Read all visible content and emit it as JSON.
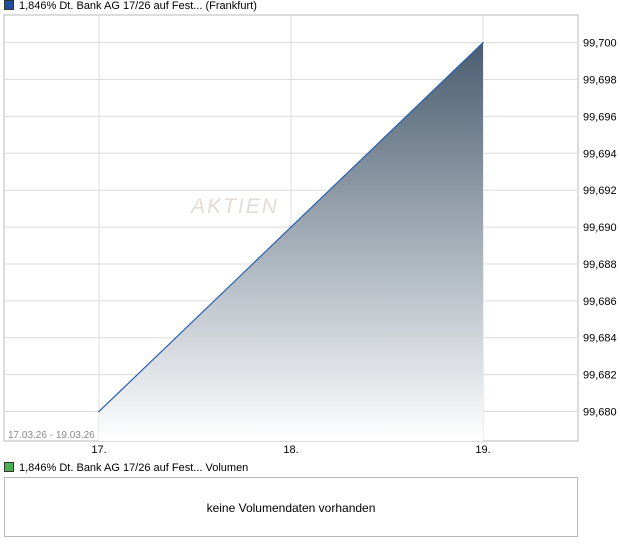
{
  "chart_title": {
    "security": "1,846% Dt. Bank AG 17/26 auf Fest...",
    "exchange": "(Frankfurt)",
    "swatch_color": "#1f4e9c"
  },
  "volume": {
    "label": "1,846% Dt. Bank AG 17/26 auf Fest... Volumen",
    "swatch_color": "#4caf50",
    "empty_message": "keine Volumendaten vorhanden"
  },
  "watermark": "AKTIEN",
  "date_range": "17.03.26 - 19.03.26",
  "chart_data": {
    "type": "area",
    "x": [
      "17.",
      "18.",
      "19."
    ],
    "values": [
      99.68,
      99.69,
      99.7
    ],
    "ylim": [
      99.6784,
      99.7015
    ],
    "y_ticks": [
      "99,680",
      "99,682",
      "99,684",
      "99,686",
      "99,688",
      "99,690",
      "99,692",
      "99,694",
      "99,696",
      "99,698",
      "99,700"
    ],
    "x_ticks": [
      "17.",
      "18.",
      "19."
    ],
    "grid": true,
    "line_color": "#2a5fa8",
    "fill_top_color": "#4a5d70",
    "fill_bottom_color": "#ffffff"
  }
}
